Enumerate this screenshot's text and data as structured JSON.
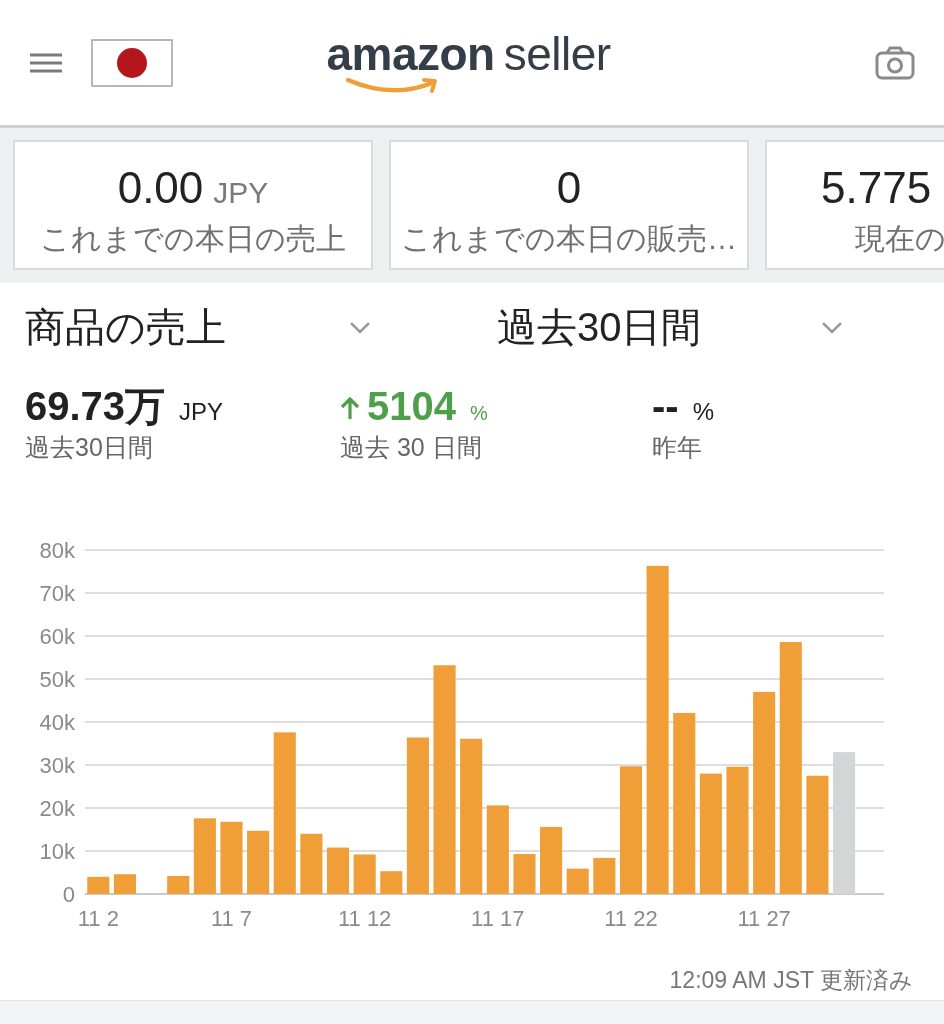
{
  "header": {
    "logo": {
      "brand": "amazon",
      "product": "seller"
    }
  },
  "summary_cards": [
    {
      "value": "0.00",
      "unit": "JPY",
      "label": "これまでの本日の売上"
    },
    {
      "value": "0",
      "label": "これまでの本日の販売…"
    },
    {
      "value": "5.775",
      "label": "現在の"
    }
  ],
  "filters": [
    {
      "label": "商品の売上"
    },
    {
      "label": "過去30日間"
    }
  ],
  "stats": [
    {
      "value": "69.73万",
      "unit": "JPY",
      "rising": false,
      "caption": "過去30日間"
    },
    {
      "value": "5104",
      "unit": "%",
      "rising": true,
      "caption": "過去 30 日間"
    },
    {
      "value": "--",
      "unit": "%",
      "rising": false,
      "caption": "昨年"
    }
  ],
  "sales_chart": {
    "chart_data": {
      "type": "bar",
      "categories": [
        "11 2",
        null,
        null,
        null,
        null,
        "11 7",
        null,
        null,
        null,
        null,
        "11 12",
        null,
        null,
        null,
        null,
        "11 17",
        null,
        null,
        null,
        null,
        "11 22",
        null,
        null,
        null,
        null,
        "11 27",
        null,
        null,
        null
      ],
      "series": [
        {
          "color": "#f09e38",
          "values": [
            4000,
            4600,
            0,
            4200,
            17600,
            16800,
            14700,
            37600,
            14000,
            10800,
            9200,
            5300,
            36400,
            53200,
            36100,
            20600,
            9300,
            15600,
            5900,
            8400,
            29700,
            76300,
            42100,
            28000,
            29600,
            47000,
            58600,
            27500,
            null
          ]
        },
        {
          "color": "#d4d5d6",
          "values": [
            null,
            null,
            null,
            null,
            null,
            null,
            null,
            null,
            null,
            null,
            null,
            null,
            null,
            null,
            null,
            null,
            null,
            null,
            null,
            null,
            null,
            null,
            null,
            null,
            null,
            null,
            null,
            null,
            33000
          ]
        }
      ],
      "ylim": [
        0,
        80000
      ],
      "yticks": [
        0,
        {
          "value": 10000,
          "label": "10k"
        },
        {
          "value": 20000,
          "label": "20k"
        },
        {
          "value": 30000,
          "label": "30k"
        },
        {
          "value": 40000,
          "label": "40k"
        },
        {
          "value": 50000,
          "label": "50k"
        },
        {
          "value": 60000,
          "label": "60k"
        },
        {
          "value": 70000,
          "label": "70k"
        },
        {
          "value": 80000,
          "label": "80k"
        }
      ],
      "grid": true
    }
  },
  "last_updated": "12:09 AM JST 更新済み"
}
